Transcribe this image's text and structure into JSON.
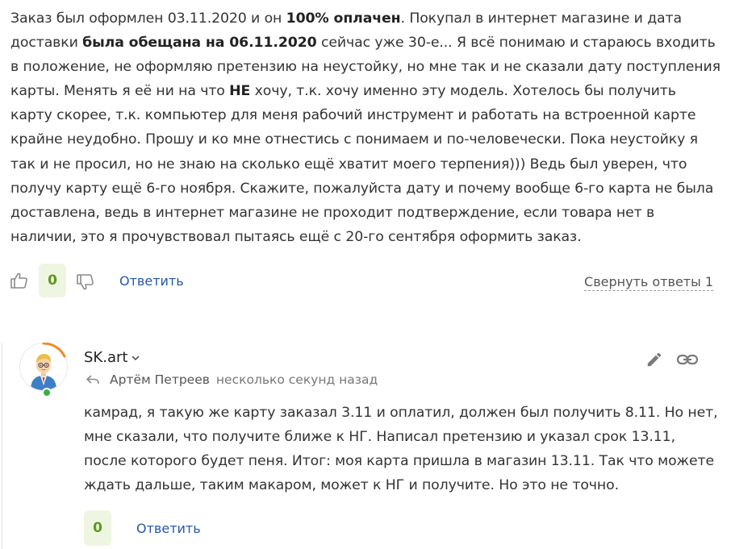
{
  "comment": {
    "segments": [
      {
        "text": "Заказ был оформлен 03.11.2020 и он ",
        "bold": false
      },
      {
        "text": "100% оплачен",
        "bold": true
      },
      {
        "text": ". Покупал в интернет магазине и дата доставки ",
        "bold": false
      },
      {
        "text": "была обещана на 06.11.2020",
        "bold": true
      },
      {
        "text": " сейчас уже 30-е... Я всё понимаю и стараюсь входить в положение, не оформляю претензию на неустойку, но мне так и не сказали дату поступления карты. Менять я её ни на что ",
        "bold": false
      },
      {
        "text": "НЕ",
        "bold": true
      },
      {
        "text": " хочу, т.к. хочу именно эту модель. Хотелось бы получить карту скорее, т.к. компьютер для меня рабочий инструмент и работать на встроенной карте крайне неудобно. Прошу и ко мне отнестись с понимаем и по-человечески. Пока неустойку я так и не просил, но не знаю на сколько ещё хватит моего терпения))) Ведь был уверен, что получу карту ещё 6-го ноября. Скажите, пожалуйста дату и почему вообще 6-го карта не была доставлена, ведь в интернет магазине не проходит подтверждение, если товара нет в наличии, это я прочувствовал пытаясь ещё с 20-го сентября оформить заказ.",
        "bold": false
      }
    ],
    "actions": {
      "like_icon": "thumbs-up-icon",
      "score": "0",
      "dislike_icon": "thumbs-down-icon",
      "reply_label": "Ответить",
      "collapse_label": "Свернуть ответы 1"
    }
  },
  "reply": {
    "author": "SK.art",
    "author_menu_icon": "chevron-down-icon",
    "reply_to_icon": "reply-arrow-icon",
    "reply_to": "Артём Петреев",
    "time": "несколько секунд назад",
    "edit_icon": "pencil-icon",
    "link_icon": "link-icon",
    "text": "камрад, я такую же карту заказал 3.11 и оплатил, должен был получить 8.11. Но нет, мне сказали, что получите ближе к НГ. Написал претензию и указал срок 13.11, после которого будет пеня. Итог: моя карта пришла в магазин 13.11. Так что можете ждать дальше, таким макаром, может к НГ и получите. Но это не точно.",
    "score": "0",
    "reply_label": "Ответить",
    "online_color": "#3cb043"
  },
  "colors": {
    "link": "#2458a6",
    "score_bg": "#eef6e2",
    "score_text": "#5b9a1c",
    "avatar_arc": "#f08a24"
  }
}
